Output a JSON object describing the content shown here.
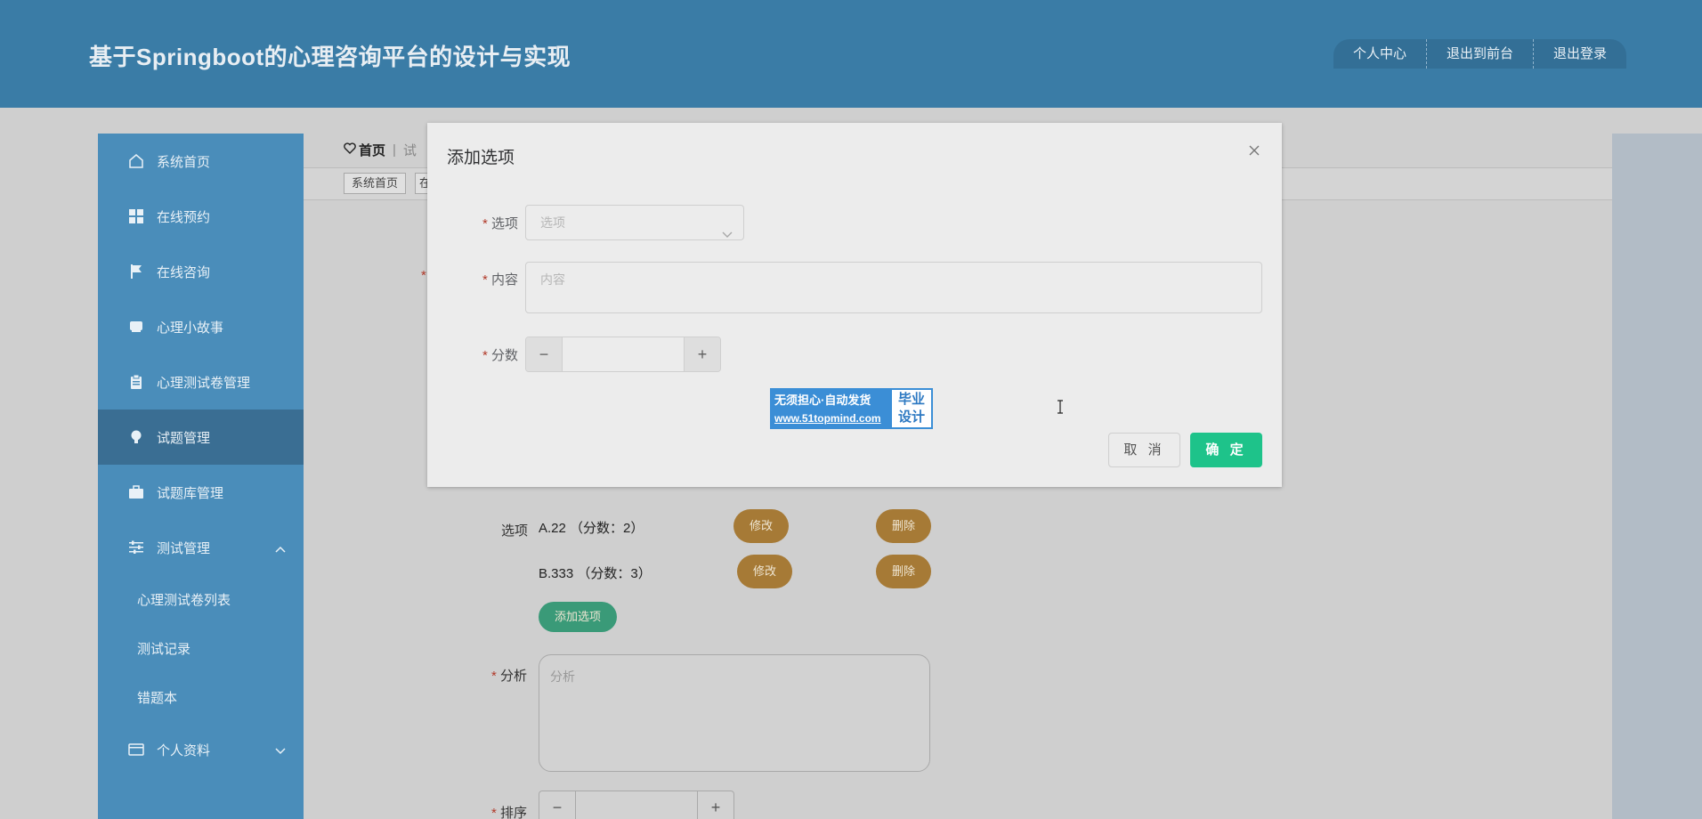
{
  "header": {
    "title": "基于Springboot的心理咨询平台的设计与实现",
    "nav": [
      "个人中心",
      "退出到前台",
      "退出登录"
    ]
  },
  "sidebar": {
    "items": [
      {
        "label": "系统首页",
        "icon": "home-icon"
      },
      {
        "label": "在线预约",
        "icon": "grid-icon"
      },
      {
        "label": "在线咨询",
        "icon": "flag-icon"
      },
      {
        "label": "心理小故事",
        "icon": "book-icon"
      },
      {
        "label": "心理测试卷管理",
        "icon": "clipboard-icon"
      },
      {
        "label": "试题管理",
        "icon": "bulb-icon",
        "active": true
      },
      {
        "label": "试题库管理",
        "icon": "briefcase-icon"
      },
      {
        "label": "测试管理",
        "icon": "sliders-icon",
        "expanded": true
      }
    ],
    "sub_items": [
      "心理测试卷列表",
      "测试记录",
      "错题本"
    ],
    "last_item": {
      "label": "个人资料",
      "icon": "card-icon"
    }
  },
  "breadcrumb": {
    "home": "首页",
    "next": "试"
  },
  "tags": {
    "first": "系统首页",
    "second": "在"
  },
  "background_form": {
    "options_label": "选项",
    "options": [
      {
        "text": "A.22 （分数：2）",
        "edit": "修改",
        "delete": "删除"
      },
      {
        "text": "B.333 （分数：3）",
        "edit": "修改",
        "delete": "删除"
      }
    ],
    "add_option": "添加选项",
    "analysis_label": "分析",
    "analysis_placeholder": "分析",
    "sort_label": "排序"
  },
  "dialog": {
    "title": "添加选项",
    "option_label": "选项",
    "option_placeholder": "选项",
    "content_label": "内容",
    "content_placeholder": "内容",
    "score_label": "分数",
    "score_value": "",
    "cancel": "取 消",
    "confirm": "确 定",
    "watermark": {
      "line1": "无须担心·自动发货",
      "line2": "www.51topmind.com",
      "right1": "毕业",
      "right2": "设计"
    }
  }
}
